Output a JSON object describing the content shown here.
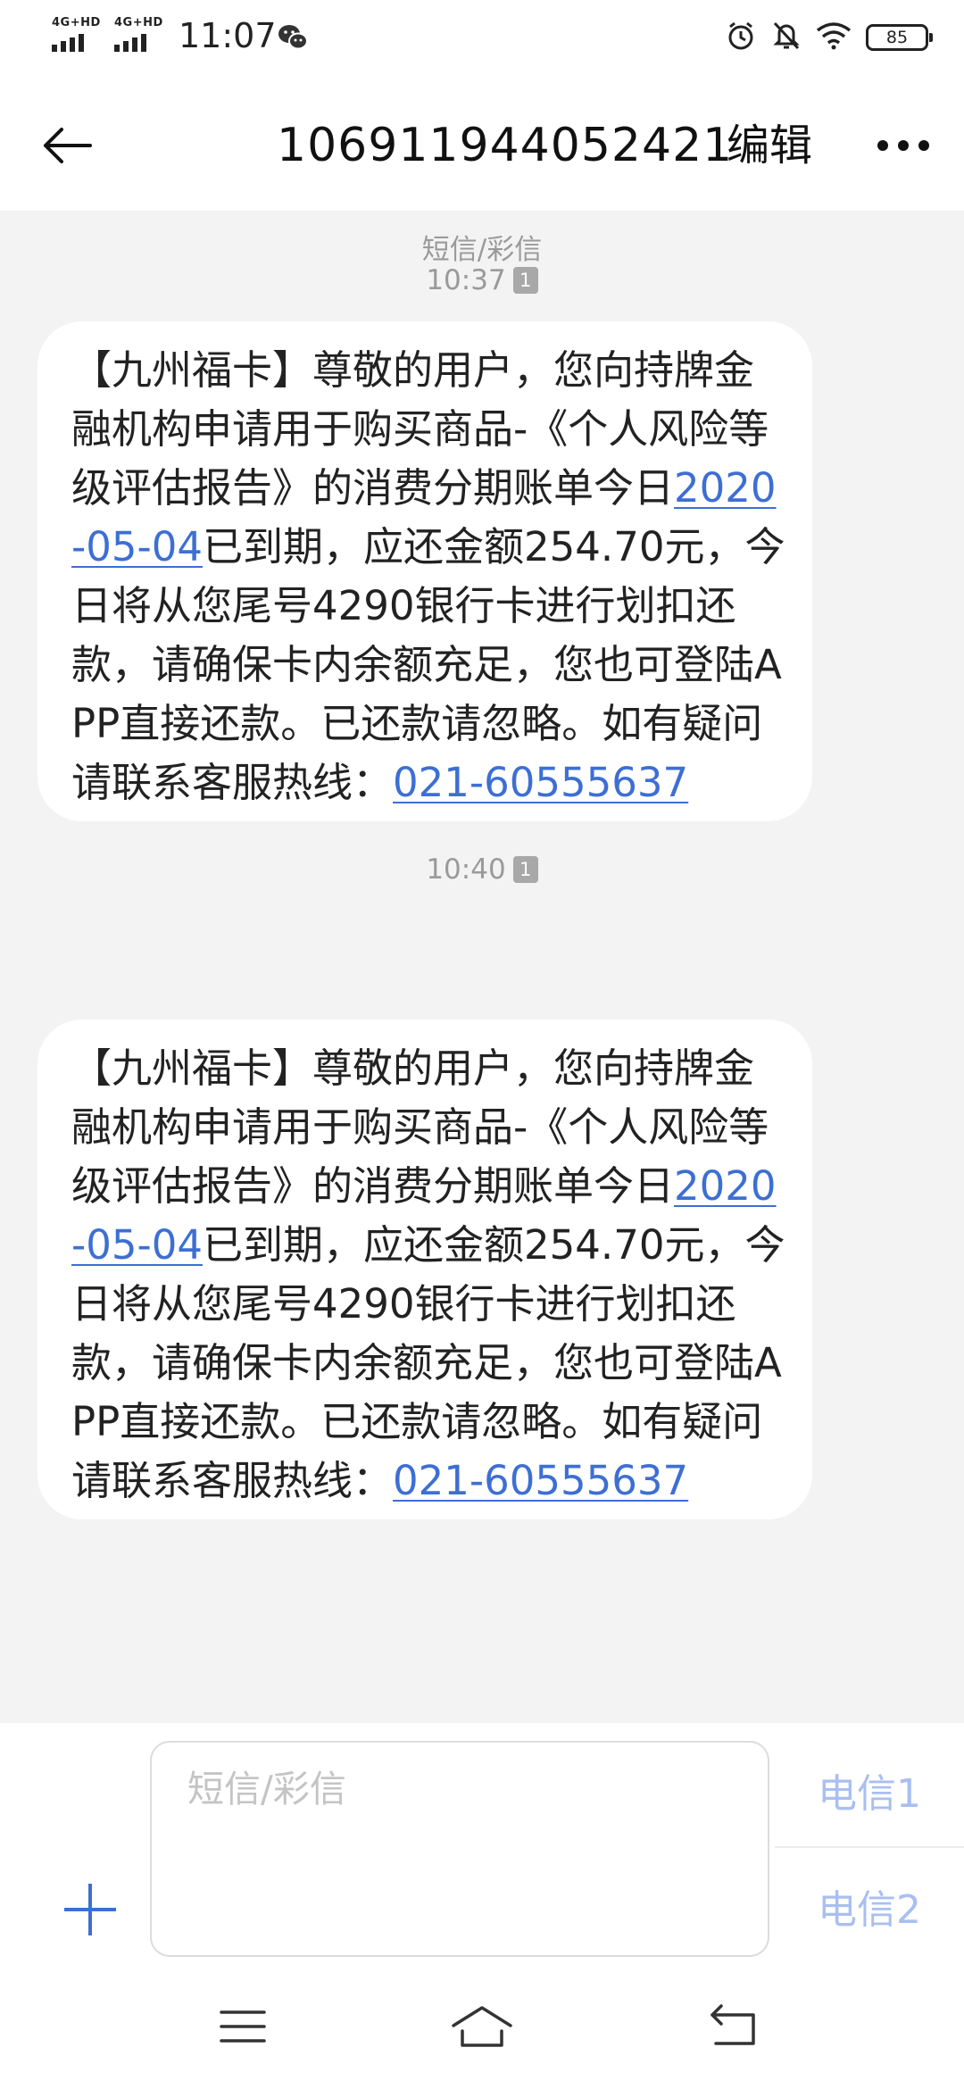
{
  "status_bar": {
    "network_1": "4G+HD",
    "network_2": "4G+HD",
    "time": "11:07",
    "battery": "85"
  },
  "header": {
    "title": "106911944052421",
    "edit_label": "编辑"
  },
  "conversation": {
    "message_type": "短信/彩信",
    "messages": [
      {
        "time": "10:37",
        "sim": "1",
        "text_before_date": "【九州福卡】尊敬的用户，您向持牌金融机构申请用于购买商品-《个人风险等级评估报告》的消费分期账单今日",
        "date_link": "2020-05-04",
        "text_middle": "已到期，应还金额254.70元，今日将从您尾号4290银行卡进行划扣还款，请确保卡内余额充足，您也可登陆APP直接还款。已还款请忽略。如有疑问请联系客服热线：",
        "phone_link": "021-60555637"
      },
      {
        "time": "10:40",
        "sim": "1",
        "text_before_date": "【九州福卡】尊敬的用户，您向持牌金融机构申请用于购买商品-《个人风险等级评估报告》的消费分期账单今日",
        "date_link": "2020-05-04",
        "text_middle": "已到期，应还金额254.70元，今日将从您尾号4290银行卡进行划扣还款，请确保卡内余额充足，您也可登陆APP直接还款。已还款请忽略。如有疑问请联系客服热线：",
        "phone_link": "021-60555637"
      }
    ]
  },
  "compose": {
    "placeholder": "短信/彩信",
    "sim1_label": "电信1",
    "sim2_label": "电信2"
  },
  "colors": {
    "link": "#3d6fd3",
    "conversation_bg": "#f3f3f3",
    "sim_button": "#a9bff0",
    "muted_text": "#9a9a9a"
  },
  "icons": {
    "back": "back-arrow-icon",
    "more": "more-dots-icon",
    "add": "plus-icon",
    "nav_menu": "menu-icon",
    "nav_home": "home-icon",
    "nav_back": "nav-back-icon"
  }
}
